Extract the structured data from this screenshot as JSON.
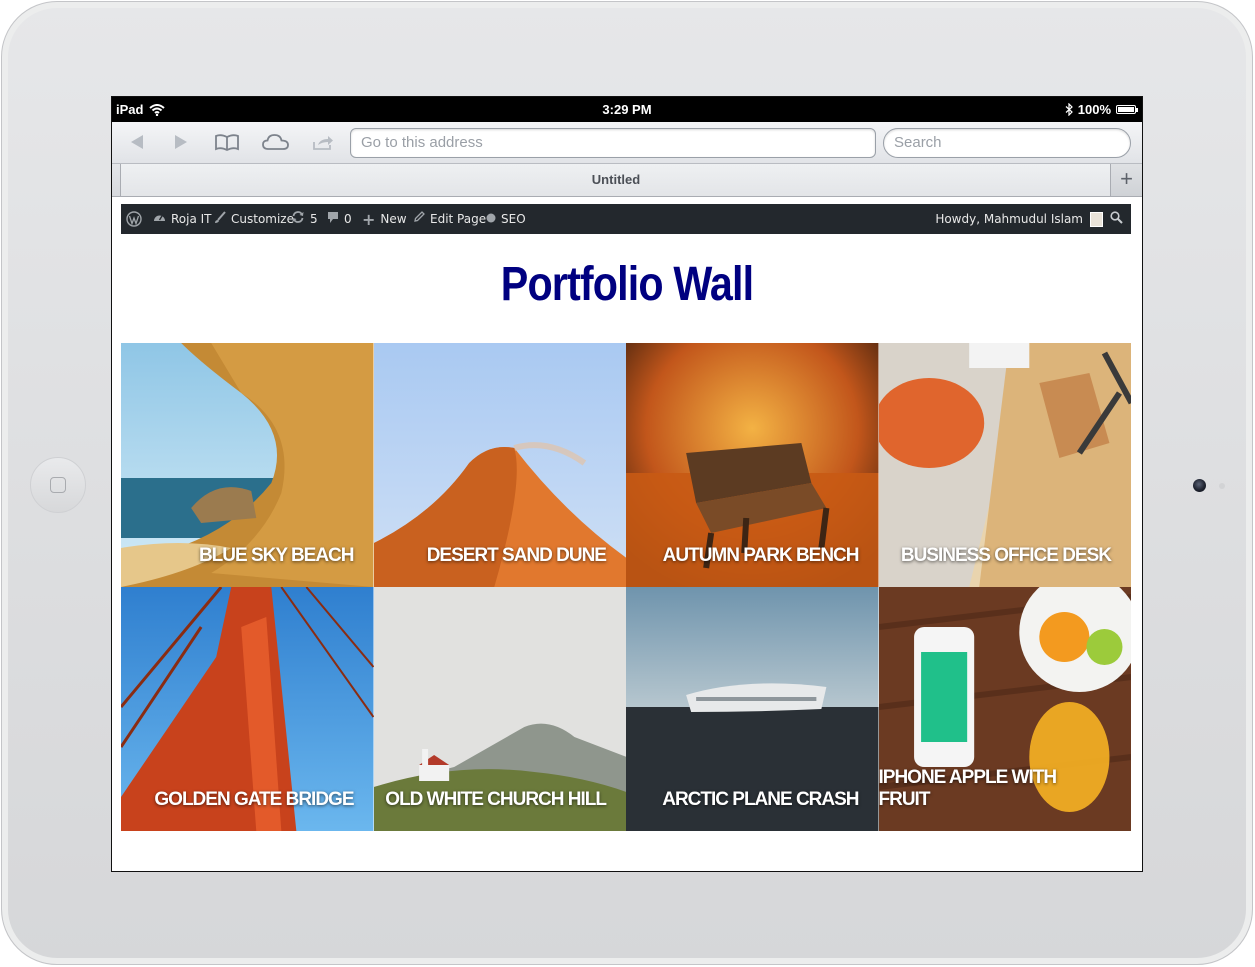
{
  "device": {
    "name": "iPad"
  },
  "status_bar": {
    "carrier": "iPad",
    "time": "3:29 PM",
    "battery": "100%"
  },
  "browser": {
    "address_placeholder": "Go to this address",
    "search_placeholder": "Search",
    "tab_title": "Untitled",
    "new_tab_label": "+"
  },
  "admin_bar": {
    "site_name": "Roja IT",
    "customize": "Customize",
    "updates_count": "5",
    "comments_count": "0",
    "new": "New",
    "edit_page": "Edit Page",
    "seo": "SEO",
    "greeting": "Howdy, Mahmudul Islam"
  },
  "page": {
    "title": "Portfolio Wall"
  },
  "portfolio": [
    {
      "caption": "BLUE SKY BEACH"
    },
    {
      "caption": "DESERT SAND DUNE"
    },
    {
      "caption": "AUTUMN PARK BENCH"
    },
    {
      "caption": "BUSINESS OFFICE DESK"
    },
    {
      "caption": "GOLDEN GATE BRIDGE"
    },
    {
      "caption": "OLD WHITE CHURCH HILL"
    },
    {
      "caption": "ARCTIC PLANE CRASH"
    },
    {
      "caption": "IPHONE APPLE WITH FRUIT"
    }
  ],
  "colors": {
    "title": "#000080",
    "admin_bar": "#23282d"
  }
}
